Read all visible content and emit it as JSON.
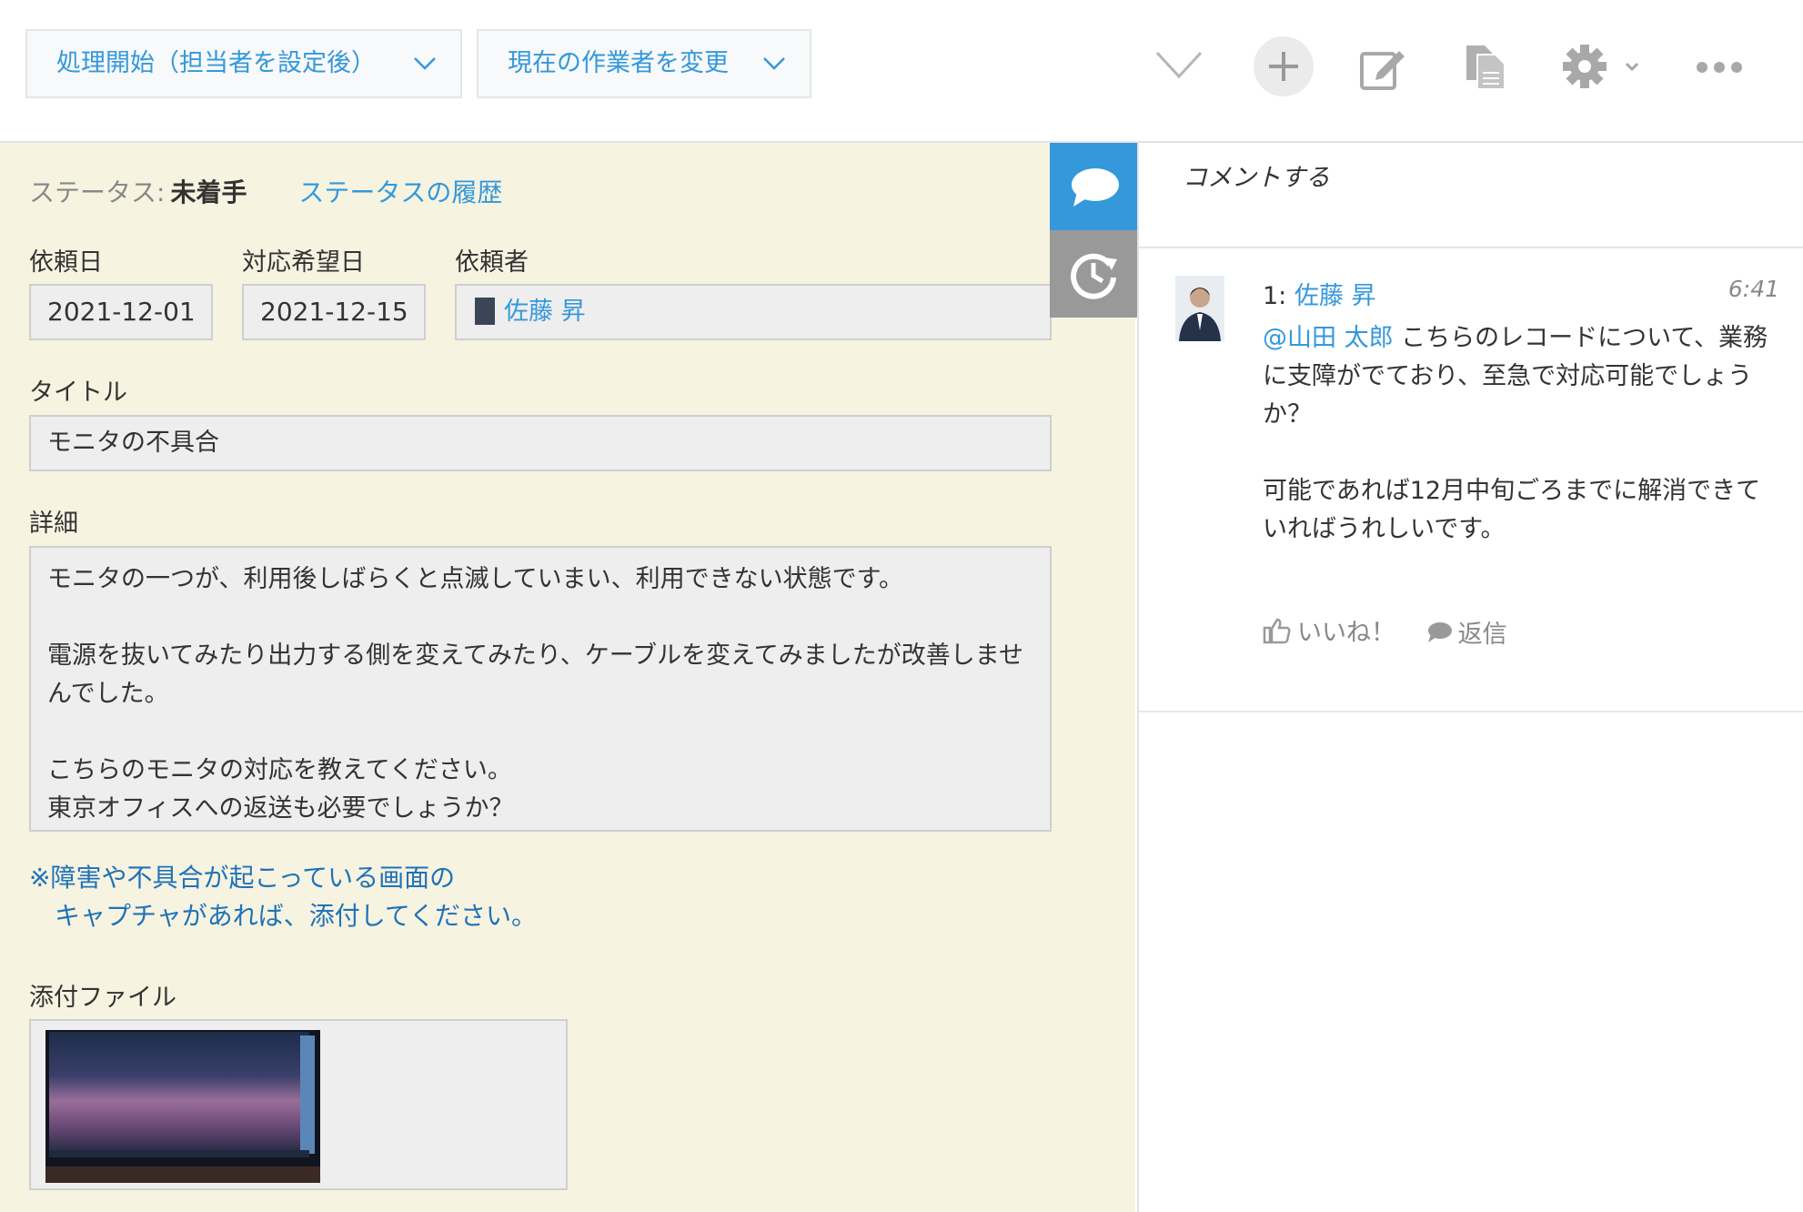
{
  "toolbar": {
    "process_start_label": "処理開始（担当者を設定後）",
    "change_assignee_label": "現在の作業者を変更"
  },
  "record": {
    "status_key": "ステータス:",
    "status_value": "未着手",
    "status_history_link": "ステータスの履歴",
    "fields": {
      "request_date": {
        "label": "依頼日",
        "value": "2021-12-01"
      },
      "desired_date": {
        "label": "対応希望日",
        "value": "2021-12-15"
      },
      "requester": {
        "label": "依頼者",
        "value": "佐藤 昇"
      },
      "title": {
        "label": "タイトル",
        "value": "モニタの不具合"
      },
      "detail": {
        "label": "詳細",
        "value": "モニタの一つが、利用後しばらくと点滅していまい、利用できない状態です。\n\n電源を抜いてみたり出力する側を変えてみたり、ケーブルを変えてみましたが改善しませんでした。\n\nこちらのモニタの対応を教えてください。\n東京オフィスへの返送も必要でしょうか？"
      },
      "note": "※障害や不具合が起こっている画面の\n　キャプチャがあれば、添付してください。",
      "attachment": {
        "label": "添付ファイル"
      }
    }
  },
  "comments": {
    "input_placeholder": "コメントする",
    "items": [
      {
        "number": "1:",
        "author": "佐藤 昇",
        "time": "6:41",
        "mention": "@山田 太郎",
        "text": " こちらのレコードについて、業務に支障がでており、至急で対応可能でしょうか？\n\n可能であれば12月中旬ごろまでに解消できていればうれしいです。",
        "like_label": "いいね！",
        "reply_label": "返信"
      }
    ]
  },
  "colors": {
    "accent": "#3498db",
    "record_bg": "#f6f3e1",
    "note_text": "#1f72b8",
    "active_tab": "#3498db",
    "inactive_tab": "#999999"
  },
  "icons": {
    "toolbar": [
      "chevron-down-icon",
      "plus-icon",
      "edit-icon",
      "duplicate-icon",
      "gear-icon",
      "more-icon"
    ],
    "sidetabs": [
      "comment-icon",
      "history-icon"
    ],
    "actions": [
      "thumbs-up-icon",
      "speech-bubble-icon"
    ]
  }
}
